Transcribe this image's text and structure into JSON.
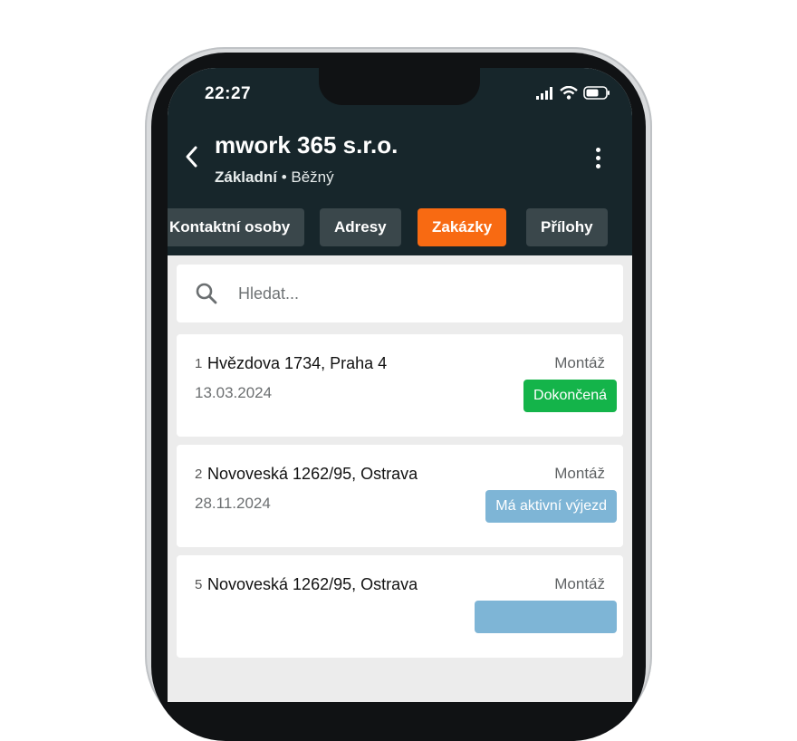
{
  "status_bar": {
    "time": "22:27"
  },
  "header": {
    "title": "mwork 365 s.r.o.",
    "subtitle_bold": "Základní",
    "subtitle_rest": " • Běžný"
  },
  "tabs": [
    {
      "label": "Kontaktní osoby",
      "active": false
    },
    {
      "label": "Adresy",
      "active": false
    },
    {
      "label": "Zakázky",
      "active": true
    },
    {
      "label": "Přílohy",
      "active": false
    }
  ],
  "search": {
    "placeholder": "Hledat..."
  },
  "orders": [
    {
      "number": "1",
      "address": "Hvězdova 1734, Praha 4",
      "date": "13.03.2024",
      "type": "Montáž",
      "status": "Dokončená",
      "status_color": "#14b44a"
    },
    {
      "number": "2",
      "address": "Novoveská 1262/95, Ostrava",
      "date": "28.11.2024",
      "type": "Montáž",
      "status": "Má aktivní výjezd",
      "status_color": "#7eb5d6"
    },
    {
      "number": "5",
      "address": "Novoveská 1262/95, Ostrava",
      "date": "",
      "type": "Montáž",
      "status": "",
      "status_color": "#7eb5d6"
    }
  ],
  "colors": {
    "header_bg": "#17262b",
    "accent": "#f86a12",
    "tab_bg": "#3a474b"
  },
  "icons": [
    "back-arrow-icon",
    "more-vertical-icon",
    "search-icon",
    "signal-icon",
    "wifi-icon",
    "battery-icon"
  ]
}
